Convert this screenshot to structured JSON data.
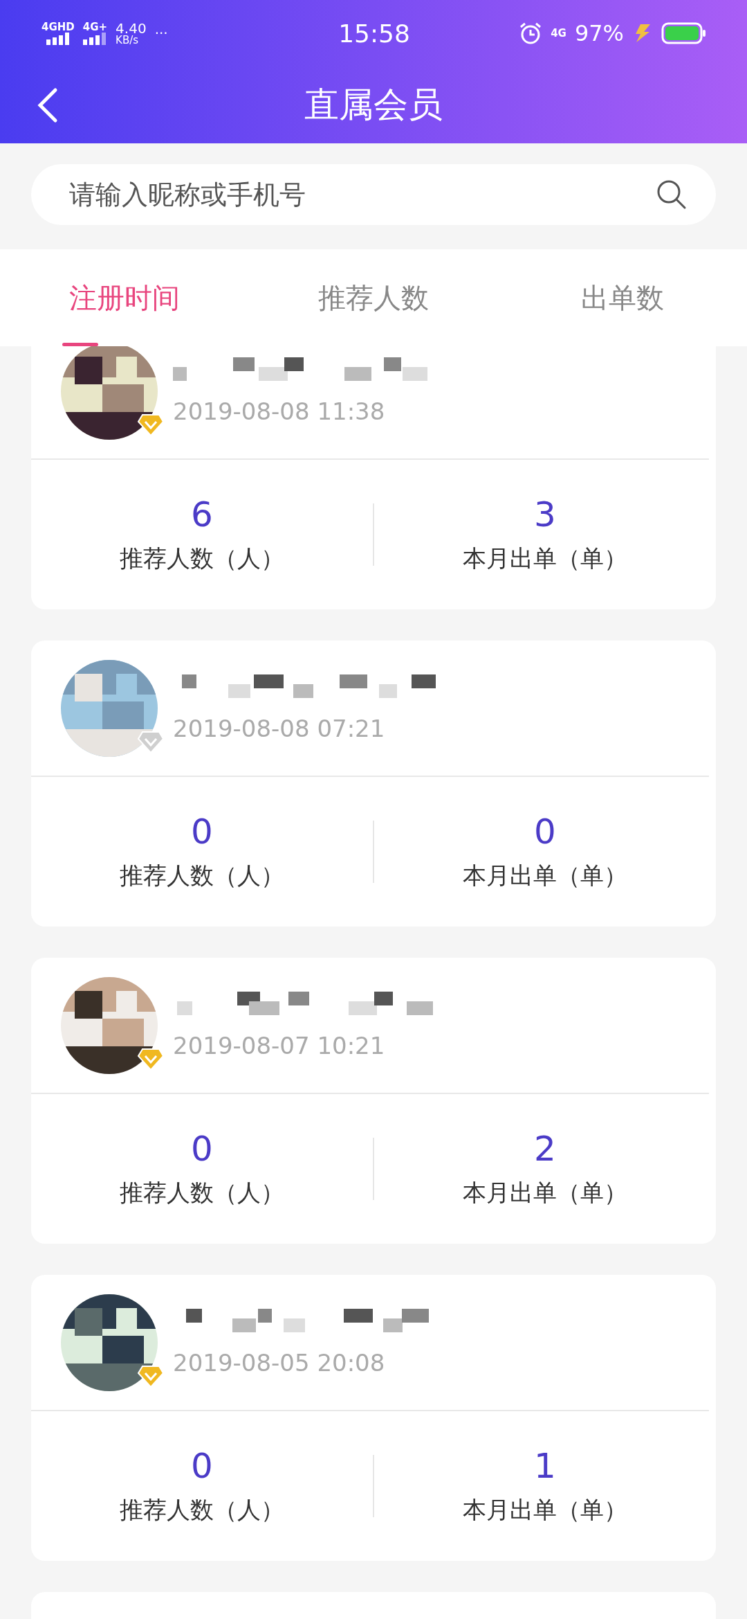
{
  "status_bar": {
    "network_1": "4GHD",
    "network_2": "4G+",
    "speed": "4.40",
    "speed_unit": "KB/s",
    "more": "···",
    "time": "15:58",
    "network_3": "4G",
    "battery": "97%"
  },
  "header": {
    "title": "直属会员"
  },
  "search": {
    "placeholder": "请输入昵称或手机号"
  },
  "tabs": [
    {
      "label": "注册时间",
      "selected": true
    },
    {
      "label": "推荐人数",
      "selected": false
    },
    {
      "label": "出单数",
      "selected": false
    }
  ],
  "members": [
    {
      "kind": "full",
      "date": "2019-08-08 11:38",
      "verified": true,
      "stats": [
        {
          "value": "6",
          "label": "推荐人数（人）"
        },
        {
          "value": "3",
          "label": "本月出单（单）"
        }
      ]
    },
    {
      "kind": "full",
      "date": "2019-08-08 07:21",
      "verified": false,
      "stats": [
        {
          "value": "0",
          "label": "推荐人数（人）"
        },
        {
          "value": "0",
          "label": "本月出单（单）"
        }
      ]
    },
    {
      "kind": "full",
      "date": "2019-08-07 10:21",
      "verified": true,
      "stats": [
        {
          "value": "0",
          "label": "推荐人数（人）"
        },
        {
          "value": "2",
          "label": "本月出单（单）"
        }
      ]
    },
    {
      "kind": "full",
      "date": "2019-08-05 20:08",
      "verified": true,
      "stats": [
        {
          "value": "0",
          "label": "推荐人数（人）"
        },
        {
          "value": "1",
          "label": "本月出单（单）"
        }
      ]
    },
    {
      "kind": "partial"
    }
  ]
}
